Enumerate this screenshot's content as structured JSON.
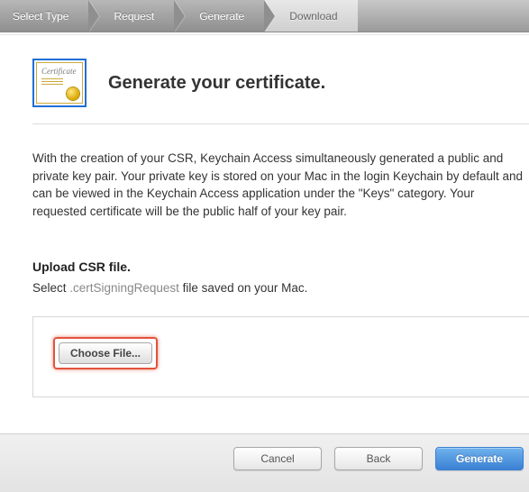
{
  "breadcrumb": {
    "items": [
      {
        "label": "Select Type",
        "active": true
      },
      {
        "label": "Request",
        "active": true
      },
      {
        "label": "Generate",
        "active": true
      },
      {
        "label": "Download",
        "active": false
      }
    ]
  },
  "header": {
    "icon_label": "Certificate",
    "title": "Generate your certificate."
  },
  "body": {
    "paragraph": "With the creation of your CSR, Keychain Access simultaneously generated a public and private key pair. Your private key is stored on your Mac in the login Keychain by default and can be viewed in the Keychain Access application under the \"Keys\" category. Your requested certificate will be the public half of your key pair.",
    "upload_heading": "Upload CSR file.",
    "select_prefix": "Select ",
    "select_ext": ".certSigningRequest",
    "select_suffix": " file saved on your Mac.",
    "choose_file_label": "Choose File..."
  },
  "footer": {
    "cancel": "Cancel",
    "back": "Back",
    "generate": "Generate"
  }
}
